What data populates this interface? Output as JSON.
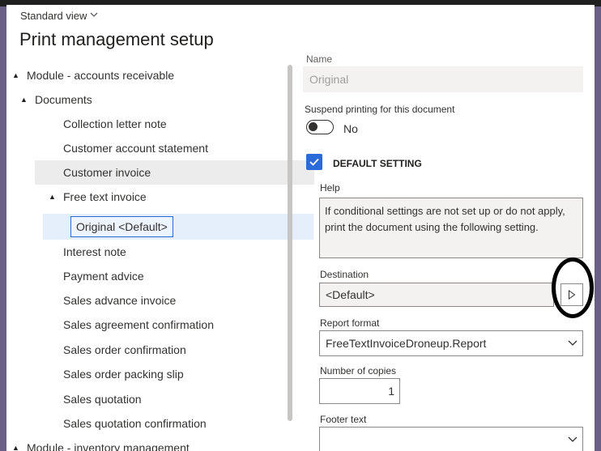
{
  "header": {
    "view_label": "Standard view",
    "title": "Print management setup"
  },
  "tree": {
    "module_ar": "Module - accounts receivable",
    "documents": "Documents",
    "items": [
      "Collection letter note",
      "Customer account statement",
      "Customer invoice",
      "Free text invoice",
      "Original <Default>",
      "Interest note",
      "Payment advice",
      "Sales advance invoice",
      "Sales agreement confirmation",
      "Sales order confirmation",
      "Sales order packing slip",
      "Sales quotation",
      "Sales quotation confirmation"
    ],
    "module_inv": "Module - inventory management"
  },
  "details": {
    "name_label": "Name",
    "name_value": "Original",
    "suspend_label": "Suspend printing for this document",
    "suspend_value": "No",
    "default_setting_label": "DEFAULT SETTING",
    "help_label": "Help",
    "help_text": "If conditional settings are not set up or do not apply, print the document using the following setting.",
    "destination_label": "Destination",
    "destination_value": "<Default>",
    "report_format_label": "Report format",
    "report_format_value": "FreeTextInvoiceDroneup.Report",
    "copies_label": "Number of copies",
    "copies_value": "1",
    "footer_label": "Footer text",
    "footer_value": ""
  },
  "colors": {
    "accent": "#2b6bd9",
    "selected_row": "#e5eefb"
  }
}
